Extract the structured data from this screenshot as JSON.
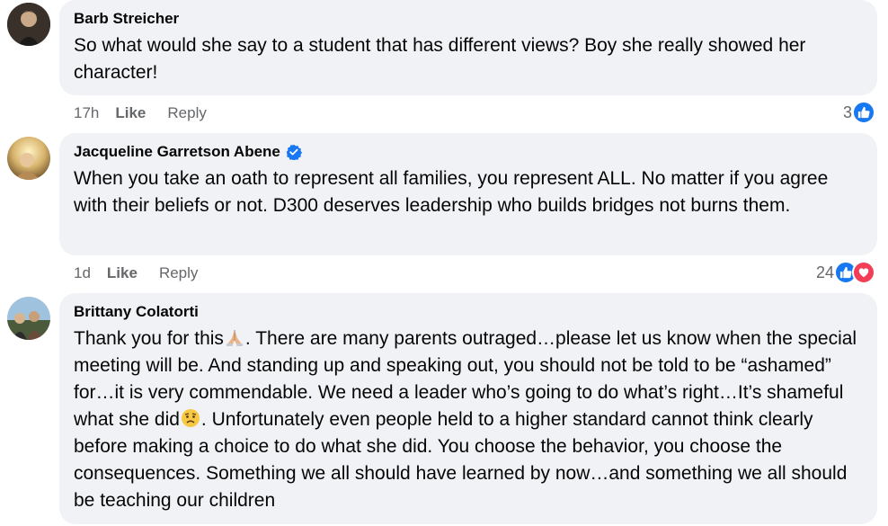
{
  "comments": [
    {
      "author": "Barb Streicher",
      "text": "So what would she say to a student that has different views? Boy she really showed her character!",
      "time": "17h",
      "like_label": "Like",
      "reply_label": "Reply",
      "reaction_count": "3",
      "reactions": [
        "like-icon"
      ]
    },
    {
      "author": "Jacqueline Garretson Abene",
      "verified": true,
      "text": "When you take an oath to represent all families, you represent ALL. No matter if you agree with their beliefs or not. D300 deserves leadership who builds bridges not burns them.",
      "time": "1d",
      "like_label": "Like",
      "reply_label": "Reply",
      "reaction_count": "24",
      "reactions": [
        "like-icon",
        "love-icon"
      ]
    },
    {
      "author": "Brittany Colatorti",
      "text_part1": "Thank you for this",
      "text_part2": ". There are many parents outraged…please let us know when the special meeting will be. And standing up and speaking out, you should not be told to be “ashamed” for…it is very commendable. We need a leader who’s going to do what’s right…It’s shameful what she did",
      "text_part3": ". Unfortunately even people held to a higher standard cannot think clearly before making a choice to do what she did. You choose the behavior, you choose the consequences. Something we all should have learned by now…and something we all should be teaching our children",
      "emojis": [
        "folded-hands-emoji",
        "sad-face-emoji"
      ]
    }
  ],
  "colors": {
    "bubble": "#f0f2f5",
    "meta": "#65676b",
    "like": "#1877f2",
    "love": "#f33e58"
  }
}
